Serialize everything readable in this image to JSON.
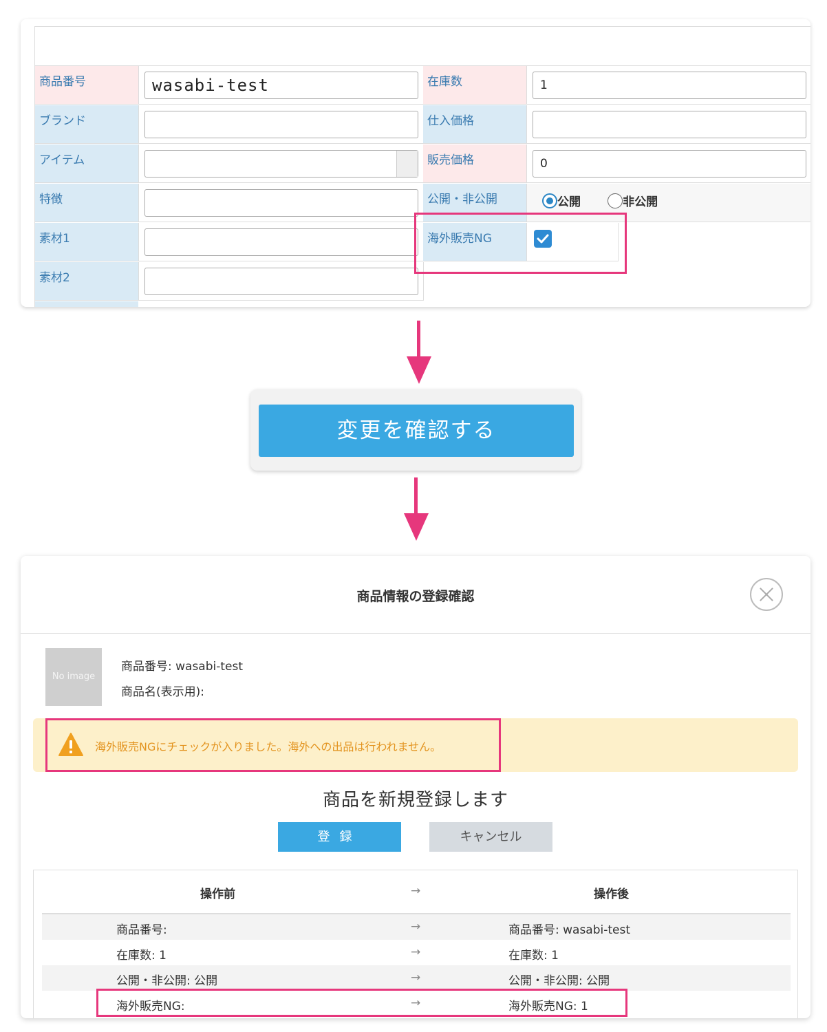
{
  "form": {
    "rows": [
      {
        "left_label": "商品番号",
        "left_value": "wasabi-test",
        "right_label": "在庫数",
        "right_value": "1"
      },
      {
        "left_label": "ブランド",
        "left_value": "",
        "right_label": "仕入価格",
        "right_value": ""
      },
      {
        "left_label": "アイテム",
        "left_value": "",
        "right_label": "販売価格",
        "right_value": "0"
      },
      {
        "left_label": "特徴",
        "left_value": "",
        "right_label": "公開・非公開"
      },
      {
        "left_label": "素材1",
        "left_value": "",
        "right_label": "海外販売NG"
      },
      {
        "left_label": "素材2",
        "left_value": ""
      }
    ],
    "visibility": {
      "public_label": "公開",
      "private_label": "非公開",
      "selected": "公開"
    },
    "overseas_ng_checked": true
  },
  "confirm_button": "変更を確認する",
  "modal": {
    "title": "商品情報の登録確認",
    "no_image": "No image",
    "product_number": "商品番号: wasabi-test",
    "product_name": "商品名(表示用):",
    "warning": "海外販売NGにチェックが入りました。海外への出品は行われません。",
    "register_message": "商品を新規登録します",
    "register_button": "登録",
    "cancel_button": "キャンセル",
    "diff": {
      "before_header": "操作前",
      "arrow": "→",
      "after_header": "操作後",
      "rows": [
        {
          "before": "商品番号:",
          "after": "商品番号: wasabi-test"
        },
        {
          "before": "在庫数: 1",
          "after": "在庫数: 1"
        },
        {
          "before": "公開・非公開: 公開",
          "after": "公開・非公開: 公開"
        },
        {
          "before": "海外販売NG:",
          "after": "海外販売NG: 1"
        }
      ]
    }
  },
  "colors": {
    "accent": "#3aa8e2",
    "highlight": "#e6377c",
    "warning_bg": "#fdf0ca",
    "warning_text": "#e39420"
  }
}
